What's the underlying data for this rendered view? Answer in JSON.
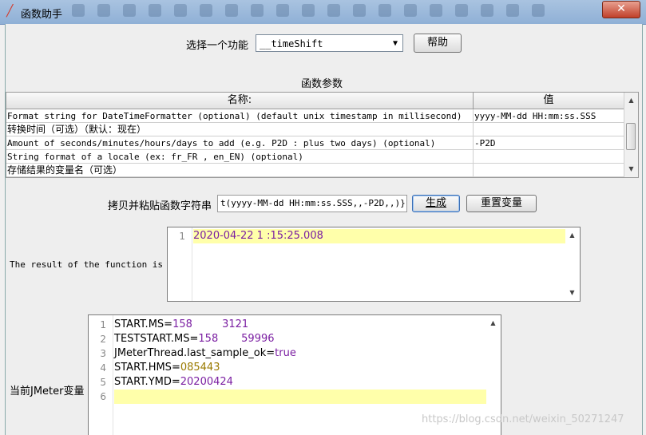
{
  "window": {
    "title": "函数助手",
    "close": "✕"
  },
  "selector": {
    "label": "选择一个功能",
    "value": "__timeShift",
    "help": "帮助"
  },
  "params": {
    "section_title": "函数参数",
    "col_name": "名称:",
    "col_value": "值",
    "rows": [
      {
        "name": "Format string for DateTimeFormatter (optional) (default unix timestamp in millisecond)",
        "value": "yyyy-MM-dd HH:mm:ss.SSS"
      },
      {
        "name": "转换时间（可选）（默认：现在）",
        "value": ""
      },
      {
        "name": "Amount of seconds/minutes/hours/days to add (e.g. P2D : plus two days) (optional)",
        "value": "-P2D"
      },
      {
        "name": "String format of a locale (ex: fr_FR , en_EN) (optional)",
        "value": ""
      },
      {
        "name": "存储结果的变量名（可选）",
        "value": ""
      }
    ]
  },
  "copy": {
    "label": "拷贝并粘贴函数字符串",
    "value": "t(yyyy-MM-dd HH:mm:ss.SSS,,-P2D,,)}",
    "generate": "生成",
    "reset": "重置变量"
  },
  "result": {
    "label": "The result of the function is",
    "lines": [
      {
        "num": "1",
        "text": "2020-04-22 1 :15:25.008"
      }
    ]
  },
  "vars": {
    "label": "当前JMeter变量",
    "lines": [
      {
        "num": "1",
        "key": "START.MS=",
        "val": "158         3121"
      },
      {
        "num": "2",
        "key": "TESTSTART.MS=",
        "val": "158       59996"
      },
      {
        "num": "3",
        "key": "JMeterThread.last_sample_ok=",
        "val": "true"
      },
      {
        "num": "4",
        "key": "START.HMS=",
        "val": "085443"
      },
      {
        "num": "5",
        "key": "START.YMD=",
        "val": "20200424"
      },
      {
        "num": "6",
        "key": "",
        "val": ""
      }
    ]
  },
  "watermark": "https://blog.csdn.net/weixin_50271247"
}
